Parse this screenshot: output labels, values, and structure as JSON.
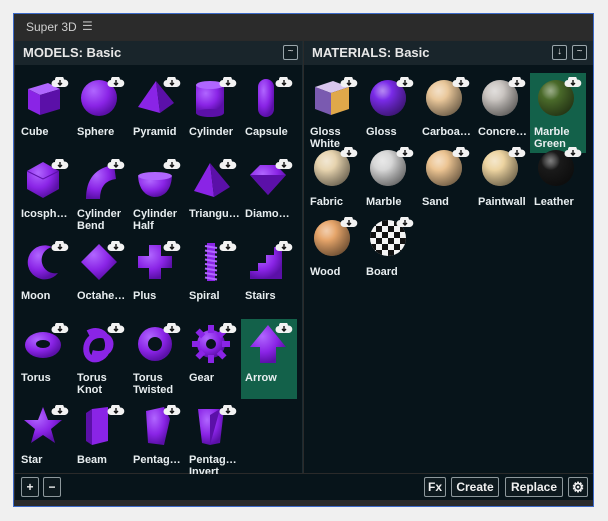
{
  "window": {
    "title": "Super 3D",
    "menu_icon": "hamburger-icon"
  },
  "models": {
    "header": "MODELS: Basic",
    "menu_symbol": "~",
    "items": [
      {
        "label": "Cube",
        "shape": "cube"
      },
      {
        "label": "Sphere",
        "shape": "sphere"
      },
      {
        "label": "Pyramid",
        "shape": "pyramid"
      },
      {
        "label": "Cylinder",
        "shape": "cylinder"
      },
      {
        "label": "Capsule",
        "shape": "capsule"
      },
      {
        "label": "Icosph…",
        "shape": "icosphere"
      },
      {
        "label": "Cylinder\nBend",
        "shape": "cylbend"
      },
      {
        "label": "Cylinder\nHalf",
        "shape": "cylhalf"
      },
      {
        "label": "Triangu…",
        "shape": "triangle"
      },
      {
        "label": "Diamo…",
        "shape": "diamond"
      },
      {
        "label": "Moon",
        "shape": "moon"
      },
      {
        "label": "Octahe…",
        "shape": "octa"
      },
      {
        "label": "Plus",
        "shape": "plus"
      },
      {
        "label": "Spiral",
        "shape": "spiral"
      },
      {
        "label": "Stairs",
        "shape": "stairs"
      },
      {
        "label": "Torus",
        "shape": "torus"
      },
      {
        "label": "Torus\nKnot",
        "shape": "knot"
      },
      {
        "label": "Torus\nTwisted",
        "shape": "twisted"
      },
      {
        "label": "Gear",
        "shape": "gear"
      },
      {
        "label": "Arrow",
        "shape": "arrow",
        "selected": true
      },
      {
        "label": "Star",
        "shape": "star"
      },
      {
        "label": "Beam",
        "shape": "beam"
      },
      {
        "label": "Pentag…",
        "shape": "pentagon"
      },
      {
        "label": "Pentag…\nInvert",
        "shape": "pentinv"
      }
    ]
  },
  "materials": {
    "header": "MATERIALS: Basic",
    "download_symbol": "↓",
    "menu_symbol": "~",
    "items": [
      {
        "label": "Gloss\nWhite",
        "type": "glosswhite"
      },
      {
        "label": "Gloss",
        "type": "gloss",
        "color": "#7a2be8"
      },
      {
        "label": "Carboa…",
        "type": "ball",
        "color": "#e9c79a"
      },
      {
        "label": "Concre…",
        "type": "ball",
        "color": "#c9c4c0"
      },
      {
        "label": "Marble\nGreen",
        "type": "ball",
        "color": "#4a6a2a",
        "selected": true
      },
      {
        "label": "Fabric",
        "type": "ball",
        "color": "#e6d3ae"
      },
      {
        "label": "Marble",
        "type": "ball",
        "color": "#d6d6d6"
      },
      {
        "label": "Sand",
        "type": "ball",
        "color": "#ecc492"
      },
      {
        "label": "Paintwall",
        "type": "ball",
        "color": "#ecd3a0"
      },
      {
        "label": "Leather",
        "type": "ball",
        "color": "#1a1a1a"
      },
      {
        "label": "Wood",
        "type": "ball",
        "color": "#e6a56a"
      },
      {
        "label": "Board",
        "type": "board"
      }
    ]
  },
  "footer": {
    "add": "+",
    "remove": "−",
    "fx": "Fx",
    "create": "Create",
    "replace": "Replace",
    "settings_icon": "gear-icon"
  },
  "colors": {
    "accent": "#8a2be2",
    "selected": "#13614a",
    "panel": "#07141a"
  }
}
